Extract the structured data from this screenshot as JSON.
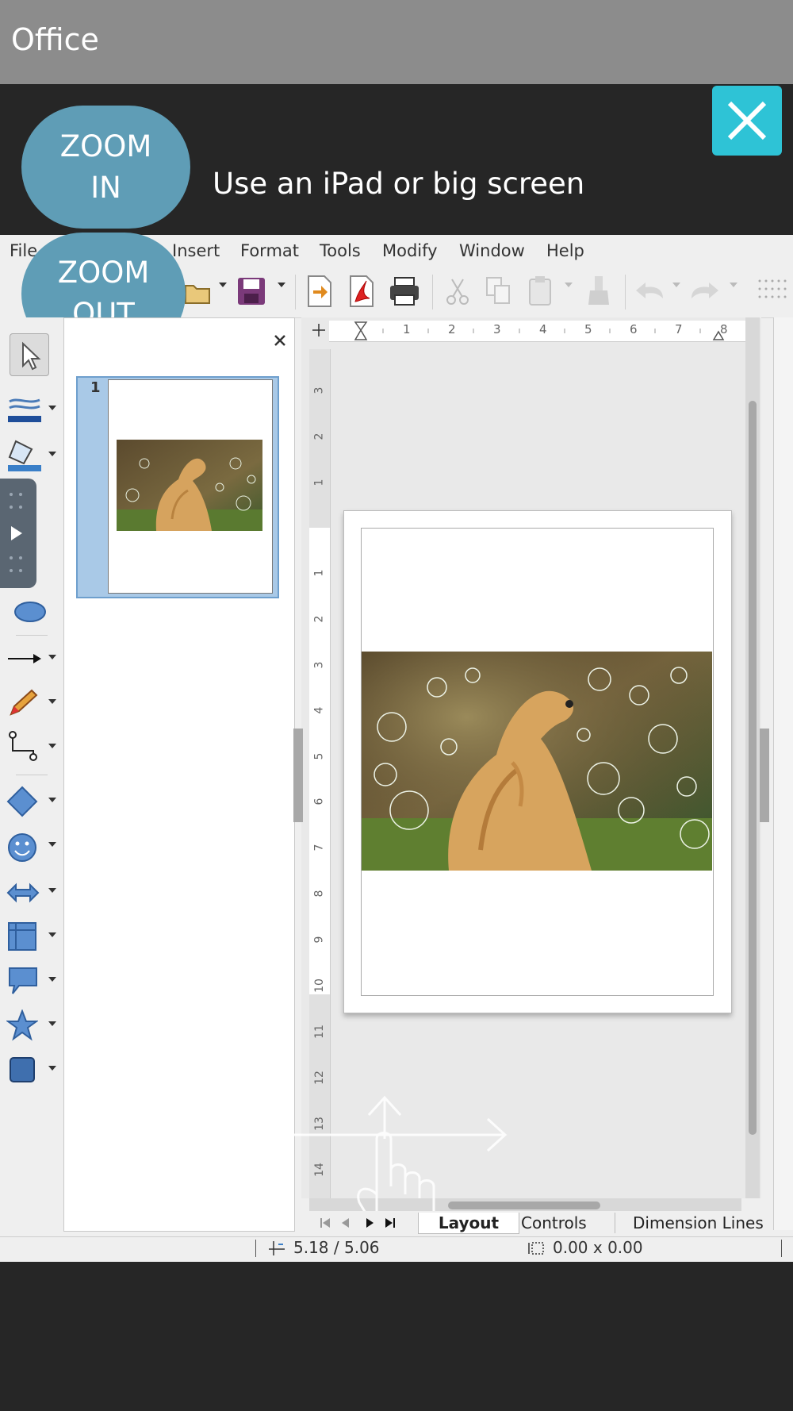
{
  "app": {
    "title": "Office"
  },
  "banner": {
    "zoom_in_line1": "ZOOM",
    "zoom_in_line2": "IN",
    "zoom_out_line1": "ZOOM",
    "zoom_out_line2": "OUT",
    "message": "Use an iPad or big screen"
  },
  "menu": {
    "items": [
      "File",
      "Insert",
      "Format",
      "Tools",
      "Modify",
      "Window",
      "Help"
    ]
  },
  "slides_pane": {
    "slide_number": "1"
  },
  "ruler": {
    "h_ticks": [
      "1",
      "2",
      "3",
      "4",
      "5",
      "6",
      "7",
      "8"
    ],
    "v_ticks_top": [
      "3",
      "2",
      "1"
    ],
    "v_ticks": [
      "1",
      "2",
      "3",
      "4",
      "5",
      "6",
      "7",
      "8",
      "9",
      "10",
      "11",
      "12",
      "13",
      "14"
    ]
  },
  "tabs": [
    "Layout",
    "Controls",
    "Dimension Lines"
  ],
  "status": {
    "position": "5.18 / 5.06",
    "size": "0.00 x 0.00"
  },
  "colors": {
    "zoom_button": "#5f9db6",
    "close_button": "#2ec3d6",
    "title_bar": "#8c8c8c"
  }
}
